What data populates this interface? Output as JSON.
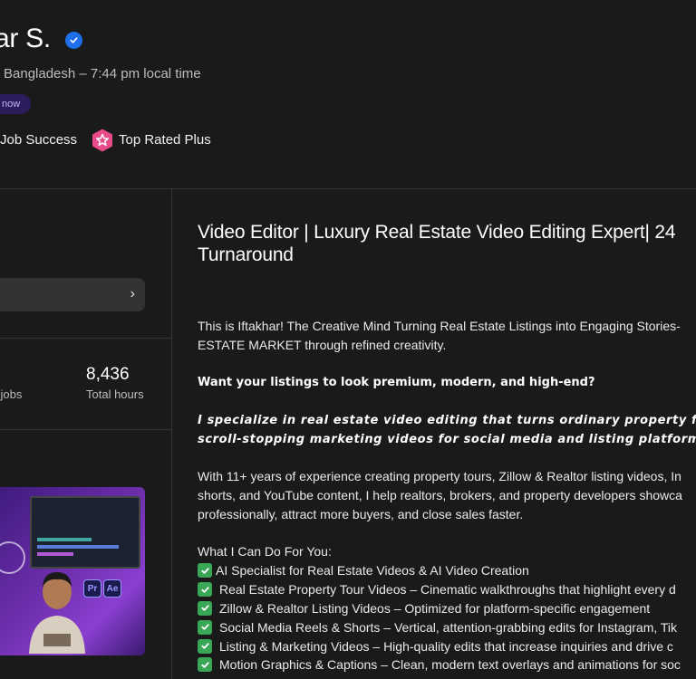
{
  "profile": {
    "name_fragment": "ar S.",
    "location": "Bangladesh – 7:44 pm local time",
    "availability_badge": "now",
    "job_success_label": "Job Success",
    "top_rated_label": "Top Rated Plus"
  },
  "sidebar": {
    "stats": {
      "jobs_label_fragment": "l jobs",
      "hours_value": "8,436",
      "hours_label": "Total hours"
    }
  },
  "main": {
    "title_line1": "Video Editor | Luxury Real Estate Video Editing Expert| 24",
    "title_line2": "Turnaround",
    "p1_line1": "This is Iftakhar! The Creative Mind Turning Real Estate Listings into Engaging Stories-",
    "p1_line2": "ESTATE MARKET through refined creativity.",
    "question": "Want your listings to look premium, modern, and high-end?",
    "specialize_line1": "I specialize in real estate video editing that turns ordinary property foota",
    "specialize_line2": "scroll-stopping marketing videos for social media and listing platforms.",
    "p2_line1": "With 11+ years of experience creating property tours, Zillow & Realtor listing videos, In",
    "p2_line2": "shorts, and YouTube content, I help realtors, brokers, and property developers showca",
    "p2_line3": "professionally, attract more buyers, and close sales faster.",
    "list_heading": "What I Can Do For You:",
    "services": [
      "AI Specialist for Real Estate Videos & AI Video Creation",
      "Real Estate Property Tour Videos – Cinematic walkthroughs that highlight every d",
      "Zillow & Realtor Listing Videos – Optimized for platform-specific engagement",
      "Social Media Reels & Shorts – Vertical, attention-grabbing edits for Instagram, Tik",
      "Listing & Marketing Videos – High-quality edits that increase inquiries and drive c",
      "Motion Graphics & Captions – Clean, modern text overlays and animations for soc"
    ]
  },
  "colors": {
    "background": "#1a1a1a",
    "verified": "#1f6feb",
    "top_rated": "#e94a8a",
    "check": "#3aa757",
    "badge_bg": "#2b1d5c"
  },
  "icons": [
    "verified-icon",
    "top-rated-icon",
    "chevron-right-icon",
    "check-icon"
  ]
}
